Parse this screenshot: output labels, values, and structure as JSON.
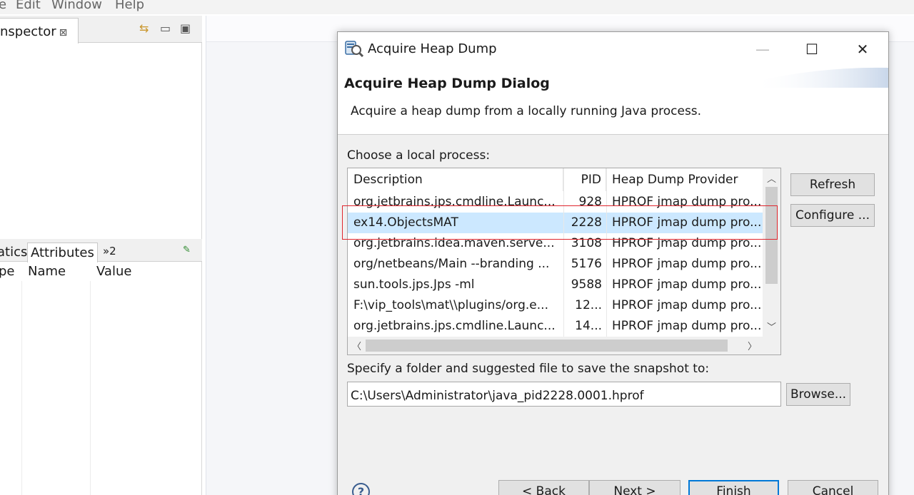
{
  "menubar": {
    "items": [
      "e",
      "Edit",
      "Window",
      "Help"
    ],
    "mnemonics": [
      "",
      "E",
      "W",
      "H"
    ]
  },
  "left_panel": {
    "view_tab_label": "nspector",
    "view_tab_close": "⊠",
    "attr_tabs": [
      "atics",
      "Attributes",
      "»2"
    ],
    "attr_columns": [
      "pe",
      "Name",
      "Value"
    ]
  },
  "dialog": {
    "title": "Acquire Heap Dump",
    "banner_title": "Acquire Heap Dump Dialog",
    "banner_description": "Acquire a heap dump from a locally running Java process.",
    "choose_label": "Choose a local process:",
    "columns": [
      "Description",
      "PID",
      "Heap Dump Provider"
    ],
    "processes": [
      {
        "description": "org.jetbrains.jps.cmdline.Launc...",
        "pid": "928",
        "provider": "HPROF jmap dump pro..."
      },
      {
        "description": "ex14.ObjectsMAT",
        "pid": "2228",
        "provider": "HPROF jmap dump pro..."
      },
      {
        "description": "org.jetbrains.idea.maven.serve...",
        "pid": "3108",
        "provider": "HPROF jmap dump pro..."
      },
      {
        "description": "org/netbeans/Main --branding ...",
        "pid": "5176",
        "provider": "HPROF jmap dump pro..."
      },
      {
        "description": "sun.tools.jps.Jps -ml",
        "pid": "9588",
        "provider": "HPROF jmap dump pro..."
      },
      {
        "description": "F:\\vip_tools\\mat\\\\plugins/org.e...",
        "pid": "12...",
        "provider": "HPROF jmap dump pro..."
      },
      {
        "description": "org.jetbrains.jps.cmdline.Launc...",
        "pid": "14...",
        "provider": "HPROF jmap dump pro..."
      }
    ],
    "selected_process_index": 1,
    "refresh_label": "Refresh",
    "configure_label": "Configure ...",
    "folder_label": "Specify a folder and suggested file to save the snapshot to:",
    "folder_value": "C:\\Users\\Administrator\\java_pid2228.0001.hprof",
    "browse_label": "Browse...",
    "back_label": "< Back",
    "next_label": "Next >",
    "finish_label": "Finish",
    "cancel_label": "Cancel",
    "help_symbol": "?"
  },
  "colors": {
    "selection": "#cce8ff",
    "default_button_border": "#0078d7",
    "annotation_box": "#e0262d"
  }
}
